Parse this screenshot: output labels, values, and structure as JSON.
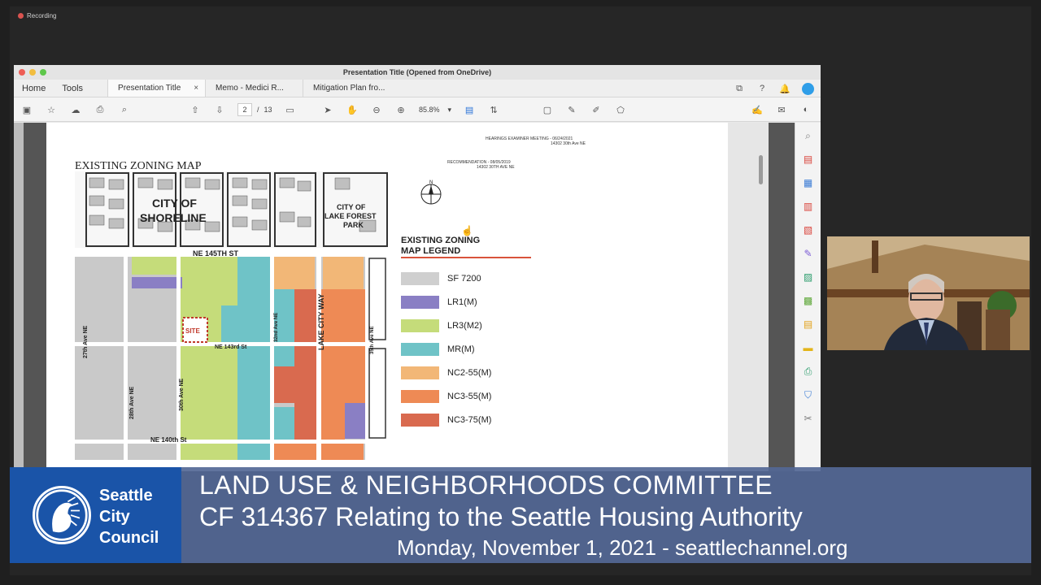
{
  "recording": {
    "label": "Recording"
  },
  "window": {
    "title": "Presentation Title (Opened from OneDrive)"
  },
  "nav": {
    "home": "Home",
    "tools": "Tools"
  },
  "tabs": [
    {
      "label": "Presentation Title",
      "close": "×"
    },
    {
      "label": "Memo - Medici R...",
      "close": ""
    },
    {
      "label": "Mitigation Plan fro...",
      "close": ""
    }
  ],
  "toolbar": {
    "page_current": "2",
    "page_sep": "/",
    "page_total": "13",
    "zoom": "85.8%",
    "zoom_caret": "▾"
  },
  "document": {
    "header_line1": "HEARINGS EXAMINER MEETING - 06/24/2021",
    "header_line2": "14302 30th Ave NE",
    "rec_line1": "RECOMMENDATION - 08/05/2019",
    "rec_line2": "14302 30TH AVE NE",
    "map_title": "EXISTING ZONING MAP",
    "compass_n": "N",
    "map_labels": {
      "shoreline_1": "CITY OF",
      "shoreline_2": "SHORELINE",
      "lfp_1": "CITY OF",
      "lfp_2": "LAKE FOREST",
      "lfp_3": "PARK",
      "ne145": "NE 145TH ST",
      "ne143": "NE 143rd St",
      "ne140": "NE 140th St",
      "ave27": "27th Ave NE",
      "ave28": "28th Ave NE",
      "ave30": "30th Ave NE",
      "ave32": "32nd Ave NE",
      "ave35": "35th Ave NE",
      "lcw": "LAKE CITY WAY",
      "site": "SITE"
    },
    "legend_title_1": "EXISTING ZONING",
    "legend_title_2": "MAP LEGEND",
    "legend": [
      {
        "label": "SF 7200",
        "color": "#cfcfcf"
      },
      {
        "label": "LR1(M)",
        "color": "#8a7fc4"
      },
      {
        "label": "LR3(M2)",
        "color": "#c5dc7a"
      },
      {
        "label": "MR(M)",
        "color": "#6fc3c7"
      },
      {
        "label": "NC2-55(M)",
        "color": "#f2b777"
      },
      {
        "label": "NC3-55(M)",
        "color": "#ee8a55"
      },
      {
        "label": "NC3-75(M)",
        "color": "#d96a4f"
      }
    ]
  },
  "lower_third": {
    "org_1": "Seattle",
    "org_2": "City",
    "org_3": "Council",
    "line1": "LAND USE & NEIGHBORHOODS COMMITTEE",
    "line2": "CF 314367 Relating to the Seattle Housing Authority",
    "line3": "Monday, November 1, 2021 - seattlechannel.org"
  }
}
